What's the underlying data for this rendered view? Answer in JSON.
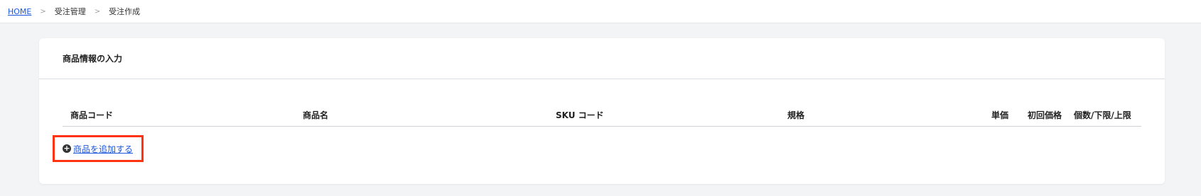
{
  "breadcrumb": {
    "home": "HOME",
    "separator": ">",
    "item1": "受注管理",
    "item2": "受注作成"
  },
  "section": {
    "title": "商品情報の入力"
  },
  "table": {
    "columns": [
      "商品コード",
      "商品名",
      "SKU コード",
      "規格",
      "単価",
      "初回価格",
      "個数/下限/上限"
    ],
    "rows": []
  },
  "actions": {
    "add_product_label": "商品を追加する",
    "add_icon": "plus-circle-icon"
  },
  "colors": {
    "link": "#1a56db",
    "highlight": "#ff3311",
    "background": "#f3f4f6"
  }
}
